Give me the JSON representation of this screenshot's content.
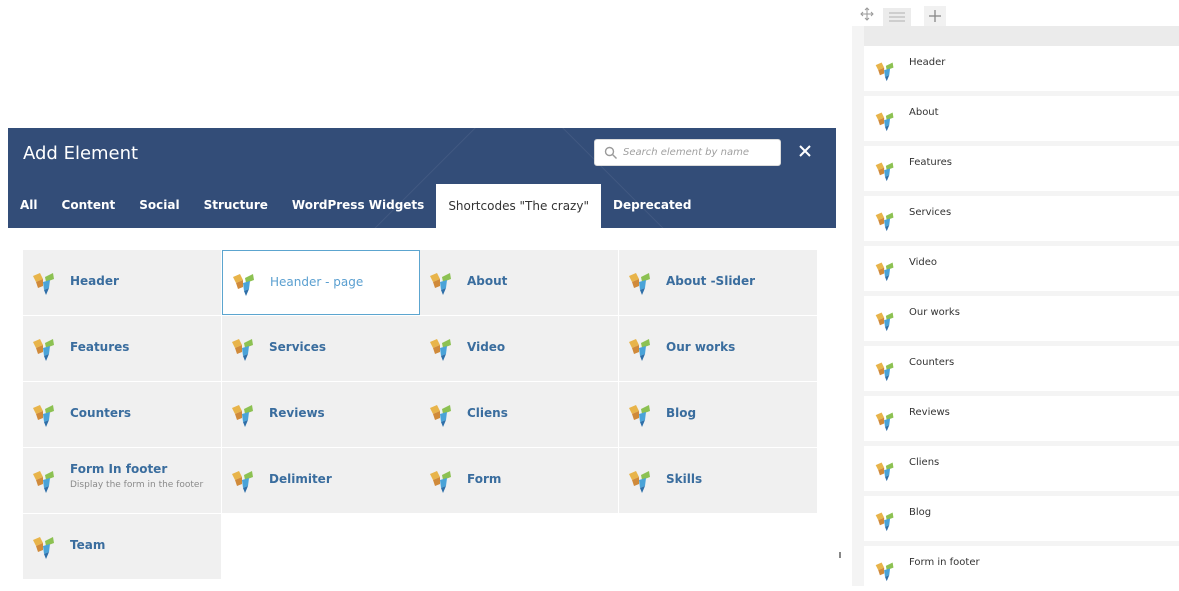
{
  "modal": {
    "title": "Add Element",
    "search_placeholder": "Search element by name",
    "tabs": [
      "All",
      "Content",
      "Social",
      "Structure",
      "WordPress Widgets",
      "Shortcodes \"The crazy\"",
      "Deprecated"
    ],
    "active_tab": "Shortcodes \"The crazy\"",
    "elements": [
      {
        "name": "Header"
      },
      {
        "name": "Heander - page",
        "selected": true
      },
      {
        "name": "About"
      },
      {
        "name": "About -Slider"
      },
      {
        "name": "Features"
      },
      {
        "name": "Services"
      },
      {
        "name": "Video"
      },
      {
        "name": "Our works"
      },
      {
        "name": "Counters"
      },
      {
        "name": "Reviews"
      },
      {
        "name": "Cliens"
      },
      {
        "name": "Blog"
      },
      {
        "name": "Form In footer",
        "description": "Display the form in the footer"
      },
      {
        "name": "Delimiter"
      },
      {
        "name": "Form"
      },
      {
        "name": "Skills"
      },
      {
        "name": "Team"
      }
    ]
  },
  "panel": {
    "items": [
      "Header",
      "About",
      "Features",
      "Services",
      "Video",
      "Our works",
      "Counters",
      "Reviews",
      "Cliens",
      "Blog",
      "Form in footer"
    ]
  },
  "colors": {
    "header_bg": "#334d78",
    "tab_text": "#ffffff",
    "element_name": "#3a6d9e",
    "card_bg": "#f0f0f0",
    "selected_border": "#5ca5cf"
  },
  "icons": {
    "element": "vc-logo-icon",
    "search": "search-icon",
    "close": "close-icon",
    "move": "move-icon",
    "menu": "menu-icon",
    "add": "plus-icon"
  }
}
